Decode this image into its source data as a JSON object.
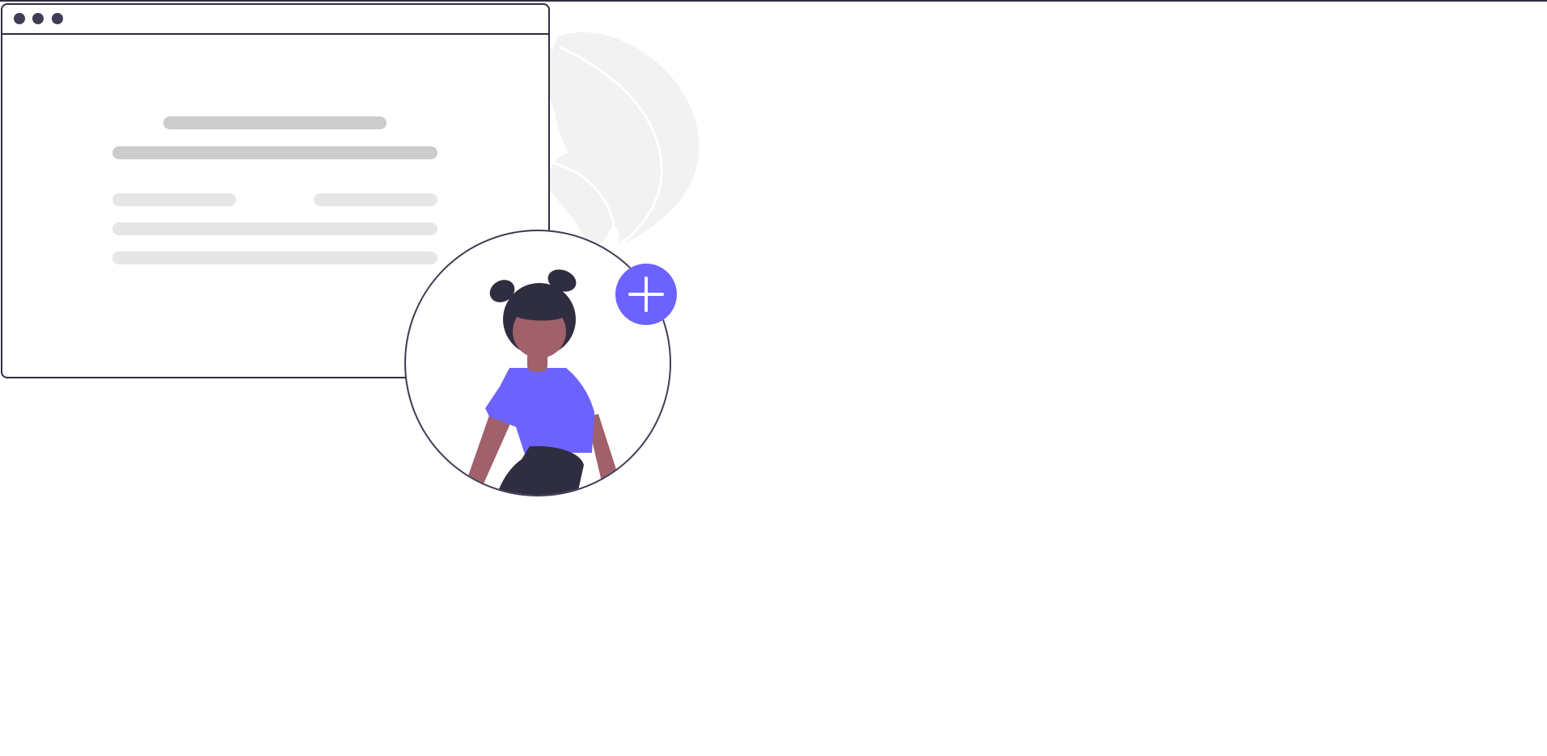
{
  "illustration": {
    "name": "add-user-profile-illustration",
    "colors": {
      "outline": "#2f2e41",
      "accent": "#6c63ff",
      "skin": "#a0616a",
      "hair": "#2f2e41",
      "placeholder_dark": "#cccccc",
      "placeholder_light": "#e6e6e6",
      "leaf": "#f2f2f2"
    },
    "window": {
      "dots": 3,
      "text_lines": 6
    },
    "add_button": {
      "icon": "plus-icon"
    }
  }
}
